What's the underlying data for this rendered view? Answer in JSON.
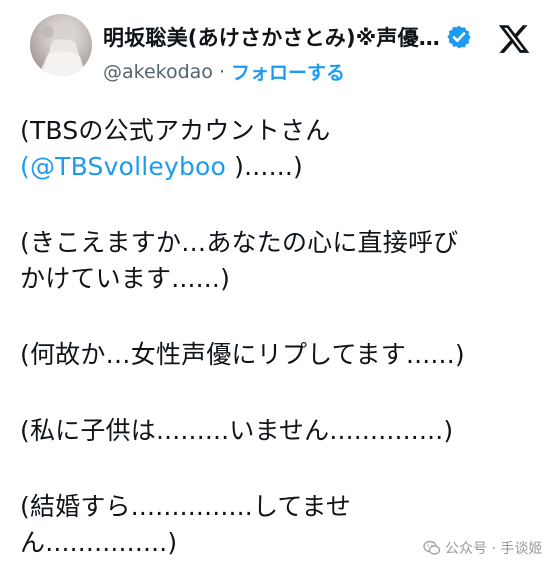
{
  "author": {
    "display_name": "明坂聡美(あけさかさとみ)※声優…",
    "handle": "@akekodao",
    "separator": "·",
    "follow_label": "フォローする",
    "verified_icon": "verified-badge-icon",
    "verified_color": "#1d9bf0"
  },
  "platform_logo": "x-logo-icon",
  "tweet": {
    "p1_line1": "(TBSの公式アカウントさん",
    "p1_mention": "(@TBSvolleyboo",
    "p1_rest": " )......)",
    "p2_line1": "(きこえますか…あなたの心に直接呼び",
    "p2_line2": "かけています......)",
    "p3_line1": "(何故か…女性声優にリプしてます......)",
    "p4_line1": "(私に子供は.........いません..............)",
    "p5_line1": "(結婚すら...............してませ",
    "p5_line2": "ん...............)"
  },
  "watermark": {
    "text": "公众号 · 手谈姬",
    "icon": "wechat-icon"
  },
  "colors": {
    "link": "#1d9bf0",
    "muted": "#536471",
    "text": "#0f1419"
  }
}
